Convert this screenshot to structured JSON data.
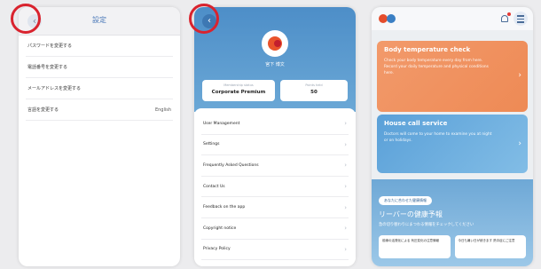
{
  "settings": {
    "title": "設定",
    "back": "‹",
    "items": [
      {
        "label": "パスワードを変更する",
        "value": ""
      },
      {
        "label": "電話番号を変更する",
        "value": ""
      },
      {
        "label": "メールアドレスを変更する",
        "value": ""
      },
      {
        "label": "言語を変更する",
        "value": "English"
      }
    ]
  },
  "account": {
    "back": "‹",
    "name": "宮下 博文",
    "plan_label": "Membership status",
    "plan_value": "Corporate Premium",
    "points_label": "Points held",
    "points_value": "50",
    "items": [
      "User Management",
      "Settings",
      "Frequently Asked Questions",
      "Contact Us",
      "Feedback on the app",
      "Copyright notice",
      "Privacy Policy"
    ],
    "chevron": "›"
  },
  "home": {
    "temp_card": {
      "title": "Body temperature check",
      "desc": "Check your body temperature every day from here. Record your daily temperature and physical conditions here.",
      "arrow": "›"
    },
    "call_card": {
      "title": "House call service",
      "desc": "Doctors will come to your home to examine you at night or on holidays.",
      "arrow": "›"
    },
    "forecast": {
      "pill": "あなたに合わせた健康情報",
      "title": "リーバーの健康予報",
      "desc": "急の切り替わりにまつわる情報をチェックしてください",
      "items": [
        "前線の活発化による 気圧変化の注意情報",
        "今日も暑い日が続きます 熱中症にご注意"
      ]
    },
    "colors": {
      "orange": "#ee8a55",
      "blue": "#5aa0d8",
      "brand_red": "#e44d2c",
      "brand_blue": "#3a7fc4"
    }
  }
}
